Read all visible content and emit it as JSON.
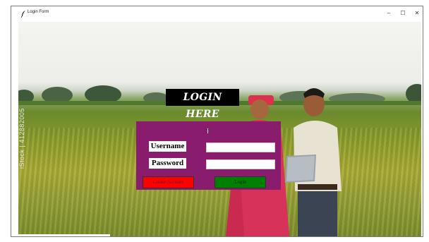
{
  "window": {
    "title": "Login Form",
    "controls": {
      "minimize": "–",
      "maximize": "☐",
      "close": "✕"
    }
  },
  "background": {
    "watermark": "iStock | 412882005"
  },
  "heading": "LOGIN HERE",
  "form": {
    "username_label": "Username",
    "password_label": "Password",
    "username_value": "",
    "password_value": "",
    "create_account_label": "Create Account",
    "login_label": "Login"
  },
  "colors": {
    "form_panel": "#8a1c6e",
    "create_button": "#ff0000",
    "login_button": "#008000",
    "heading_bg": "#000000"
  },
  "icons": {
    "app": "feather-icon"
  }
}
